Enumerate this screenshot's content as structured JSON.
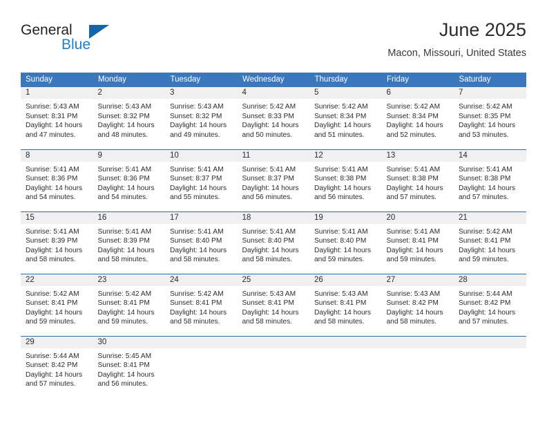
{
  "brand": {
    "name_part1": "General",
    "name_part2": "Blue",
    "triangle_color": "#1265a8",
    "blue_color": "#1c7fd1"
  },
  "header": {
    "title": "June 2025",
    "subtitle": "Macon, Missouri, United States"
  },
  "theme": {
    "header_bg": "#3b77bc",
    "row_border": "#2e6da4",
    "daynum_bg": "#f0f0f0",
    "text": "#2b2b2b"
  },
  "weekday_headers": [
    "Sunday",
    "Monday",
    "Tuesday",
    "Wednesday",
    "Thursday",
    "Friday",
    "Saturday"
  ],
  "labels": {
    "sunrise_prefix": "Sunrise:",
    "sunset_prefix": "Sunset:",
    "daylight_prefix": "Daylight:"
  },
  "days": [
    {
      "date": "1",
      "sunrise_line": "Sunrise: 5:43 AM",
      "sunset_line": "Sunset: 8:31 PM",
      "daylight_line1": "Daylight: 14 hours",
      "daylight_line2": "and 47 minutes.",
      "sunrise": "5:43 AM",
      "sunset": "8:31 PM",
      "daylight_hours": 14,
      "daylight_minutes": 47
    },
    {
      "date": "2",
      "sunrise_line": "Sunrise: 5:43 AM",
      "sunset_line": "Sunset: 8:32 PM",
      "daylight_line1": "Daylight: 14 hours",
      "daylight_line2": "and 48 minutes.",
      "sunrise": "5:43 AM",
      "sunset": "8:32 PM",
      "daylight_hours": 14,
      "daylight_minutes": 48
    },
    {
      "date": "3",
      "sunrise_line": "Sunrise: 5:43 AM",
      "sunset_line": "Sunset: 8:32 PM",
      "daylight_line1": "Daylight: 14 hours",
      "daylight_line2": "and 49 minutes.",
      "sunrise": "5:43 AM",
      "sunset": "8:32 PM",
      "daylight_hours": 14,
      "daylight_minutes": 49
    },
    {
      "date": "4",
      "sunrise_line": "Sunrise: 5:42 AM",
      "sunset_line": "Sunset: 8:33 PM",
      "daylight_line1": "Daylight: 14 hours",
      "daylight_line2": "and 50 minutes.",
      "sunrise": "5:42 AM",
      "sunset": "8:33 PM",
      "daylight_hours": 14,
      "daylight_minutes": 50
    },
    {
      "date": "5",
      "sunrise_line": "Sunrise: 5:42 AM",
      "sunset_line": "Sunset: 8:34 PM",
      "daylight_line1": "Daylight: 14 hours",
      "daylight_line2": "and 51 minutes.",
      "sunrise": "5:42 AM",
      "sunset": "8:34 PM",
      "daylight_hours": 14,
      "daylight_minutes": 51
    },
    {
      "date": "6",
      "sunrise_line": "Sunrise: 5:42 AM",
      "sunset_line": "Sunset: 8:34 PM",
      "daylight_line1": "Daylight: 14 hours",
      "daylight_line2": "and 52 minutes.",
      "sunrise": "5:42 AM",
      "sunset": "8:34 PM",
      "daylight_hours": 14,
      "daylight_minutes": 52
    },
    {
      "date": "7",
      "sunrise_line": "Sunrise: 5:42 AM",
      "sunset_line": "Sunset: 8:35 PM",
      "daylight_line1": "Daylight: 14 hours",
      "daylight_line2": "and 53 minutes.",
      "sunrise": "5:42 AM",
      "sunset": "8:35 PM",
      "daylight_hours": 14,
      "daylight_minutes": 53
    },
    {
      "date": "8",
      "sunrise_line": "Sunrise: 5:41 AM",
      "sunset_line": "Sunset: 8:36 PM",
      "daylight_line1": "Daylight: 14 hours",
      "daylight_line2": "and 54 minutes.",
      "sunrise": "5:41 AM",
      "sunset": "8:36 PM",
      "daylight_hours": 14,
      "daylight_minutes": 54
    },
    {
      "date": "9",
      "sunrise_line": "Sunrise: 5:41 AM",
      "sunset_line": "Sunset: 8:36 PM",
      "daylight_line1": "Daylight: 14 hours",
      "daylight_line2": "and 54 minutes.",
      "sunrise": "5:41 AM",
      "sunset": "8:36 PM",
      "daylight_hours": 14,
      "daylight_minutes": 54
    },
    {
      "date": "10",
      "sunrise_line": "Sunrise: 5:41 AM",
      "sunset_line": "Sunset: 8:37 PM",
      "daylight_line1": "Daylight: 14 hours",
      "daylight_line2": "and 55 minutes.",
      "sunrise": "5:41 AM",
      "sunset": "8:37 PM",
      "daylight_hours": 14,
      "daylight_minutes": 55
    },
    {
      "date": "11",
      "sunrise_line": "Sunrise: 5:41 AM",
      "sunset_line": "Sunset: 8:37 PM",
      "daylight_line1": "Daylight: 14 hours",
      "daylight_line2": "and 56 minutes.",
      "sunrise": "5:41 AM",
      "sunset": "8:37 PM",
      "daylight_hours": 14,
      "daylight_minutes": 56
    },
    {
      "date": "12",
      "sunrise_line": "Sunrise: 5:41 AM",
      "sunset_line": "Sunset: 8:38 PM",
      "daylight_line1": "Daylight: 14 hours",
      "daylight_line2": "and 56 minutes.",
      "sunrise": "5:41 AM",
      "sunset": "8:38 PM",
      "daylight_hours": 14,
      "daylight_minutes": 56
    },
    {
      "date": "13",
      "sunrise_line": "Sunrise: 5:41 AM",
      "sunset_line": "Sunset: 8:38 PM",
      "daylight_line1": "Daylight: 14 hours",
      "daylight_line2": "and 57 minutes.",
      "sunrise": "5:41 AM",
      "sunset": "8:38 PM",
      "daylight_hours": 14,
      "daylight_minutes": 57
    },
    {
      "date": "14",
      "sunrise_line": "Sunrise: 5:41 AM",
      "sunset_line": "Sunset: 8:38 PM",
      "daylight_line1": "Daylight: 14 hours",
      "daylight_line2": "and 57 minutes.",
      "sunrise": "5:41 AM",
      "sunset": "8:38 PM",
      "daylight_hours": 14,
      "daylight_minutes": 57
    },
    {
      "date": "15",
      "sunrise_line": "Sunrise: 5:41 AM",
      "sunset_line": "Sunset: 8:39 PM",
      "daylight_line1": "Daylight: 14 hours",
      "daylight_line2": "and 58 minutes.",
      "sunrise": "5:41 AM",
      "sunset": "8:39 PM",
      "daylight_hours": 14,
      "daylight_minutes": 58
    },
    {
      "date": "16",
      "sunrise_line": "Sunrise: 5:41 AM",
      "sunset_line": "Sunset: 8:39 PM",
      "daylight_line1": "Daylight: 14 hours",
      "daylight_line2": "and 58 minutes.",
      "sunrise": "5:41 AM",
      "sunset": "8:39 PM",
      "daylight_hours": 14,
      "daylight_minutes": 58
    },
    {
      "date": "17",
      "sunrise_line": "Sunrise: 5:41 AM",
      "sunset_line": "Sunset: 8:40 PM",
      "daylight_line1": "Daylight: 14 hours",
      "daylight_line2": "and 58 minutes.",
      "sunrise": "5:41 AM",
      "sunset": "8:40 PM",
      "daylight_hours": 14,
      "daylight_minutes": 58
    },
    {
      "date": "18",
      "sunrise_line": "Sunrise: 5:41 AM",
      "sunset_line": "Sunset: 8:40 PM",
      "daylight_line1": "Daylight: 14 hours",
      "daylight_line2": "and 58 minutes.",
      "sunrise": "5:41 AM",
      "sunset": "8:40 PM",
      "daylight_hours": 14,
      "daylight_minutes": 58
    },
    {
      "date": "19",
      "sunrise_line": "Sunrise: 5:41 AM",
      "sunset_line": "Sunset: 8:40 PM",
      "daylight_line1": "Daylight: 14 hours",
      "daylight_line2": "and 59 minutes.",
      "sunrise": "5:41 AM",
      "sunset": "8:40 PM",
      "daylight_hours": 14,
      "daylight_minutes": 59
    },
    {
      "date": "20",
      "sunrise_line": "Sunrise: 5:41 AM",
      "sunset_line": "Sunset: 8:41 PM",
      "daylight_line1": "Daylight: 14 hours",
      "daylight_line2": "and 59 minutes.",
      "sunrise": "5:41 AM",
      "sunset": "8:41 PM",
      "daylight_hours": 14,
      "daylight_minutes": 59
    },
    {
      "date": "21",
      "sunrise_line": "Sunrise: 5:42 AM",
      "sunset_line": "Sunset: 8:41 PM",
      "daylight_line1": "Daylight: 14 hours",
      "daylight_line2": "and 59 minutes.",
      "sunrise": "5:42 AM",
      "sunset": "8:41 PM",
      "daylight_hours": 14,
      "daylight_minutes": 59
    },
    {
      "date": "22",
      "sunrise_line": "Sunrise: 5:42 AM",
      "sunset_line": "Sunset: 8:41 PM",
      "daylight_line1": "Daylight: 14 hours",
      "daylight_line2": "and 59 minutes.",
      "sunrise": "5:42 AM",
      "sunset": "8:41 PM",
      "daylight_hours": 14,
      "daylight_minutes": 59
    },
    {
      "date": "23",
      "sunrise_line": "Sunrise: 5:42 AM",
      "sunset_line": "Sunset: 8:41 PM",
      "daylight_line1": "Daylight: 14 hours",
      "daylight_line2": "and 59 minutes.",
      "sunrise": "5:42 AM",
      "sunset": "8:41 PM",
      "daylight_hours": 14,
      "daylight_minutes": 59
    },
    {
      "date": "24",
      "sunrise_line": "Sunrise: 5:42 AM",
      "sunset_line": "Sunset: 8:41 PM",
      "daylight_line1": "Daylight: 14 hours",
      "daylight_line2": "and 58 minutes.",
      "sunrise": "5:42 AM",
      "sunset": "8:41 PM",
      "daylight_hours": 14,
      "daylight_minutes": 58
    },
    {
      "date": "25",
      "sunrise_line": "Sunrise: 5:43 AM",
      "sunset_line": "Sunset: 8:41 PM",
      "daylight_line1": "Daylight: 14 hours",
      "daylight_line2": "and 58 minutes.",
      "sunrise": "5:43 AM",
      "sunset": "8:41 PM",
      "daylight_hours": 14,
      "daylight_minutes": 58
    },
    {
      "date": "26",
      "sunrise_line": "Sunrise: 5:43 AM",
      "sunset_line": "Sunset: 8:41 PM",
      "daylight_line1": "Daylight: 14 hours",
      "daylight_line2": "and 58 minutes.",
      "sunrise": "5:43 AM",
      "sunset": "8:41 PM",
      "daylight_hours": 14,
      "daylight_minutes": 58
    },
    {
      "date": "27",
      "sunrise_line": "Sunrise: 5:43 AM",
      "sunset_line": "Sunset: 8:42 PM",
      "daylight_line1": "Daylight: 14 hours",
      "daylight_line2": "and 58 minutes.",
      "sunrise": "5:43 AM",
      "sunset": "8:42 PM",
      "daylight_hours": 14,
      "daylight_minutes": 58
    },
    {
      "date": "28",
      "sunrise_line": "Sunrise: 5:44 AM",
      "sunset_line": "Sunset: 8:42 PM",
      "daylight_line1": "Daylight: 14 hours",
      "daylight_line2": "and 57 minutes.",
      "sunrise": "5:44 AM",
      "sunset": "8:42 PM",
      "daylight_hours": 14,
      "daylight_minutes": 57
    },
    {
      "date": "29",
      "sunrise_line": "Sunrise: 5:44 AM",
      "sunset_line": "Sunset: 8:42 PM",
      "daylight_line1": "Daylight: 14 hours",
      "daylight_line2": "and 57 minutes.",
      "sunrise": "5:44 AM",
      "sunset": "8:42 PM",
      "daylight_hours": 14,
      "daylight_minutes": 57
    },
    {
      "date": "30",
      "sunrise_line": "Sunrise: 5:45 AM",
      "sunset_line": "Sunset: 8:41 PM",
      "daylight_line1": "Daylight: 14 hours",
      "daylight_line2": "and 56 minutes.",
      "sunrise": "5:45 AM",
      "sunset": "8:41 PM",
      "daylight_hours": 14,
      "daylight_minutes": 56
    }
  ]
}
